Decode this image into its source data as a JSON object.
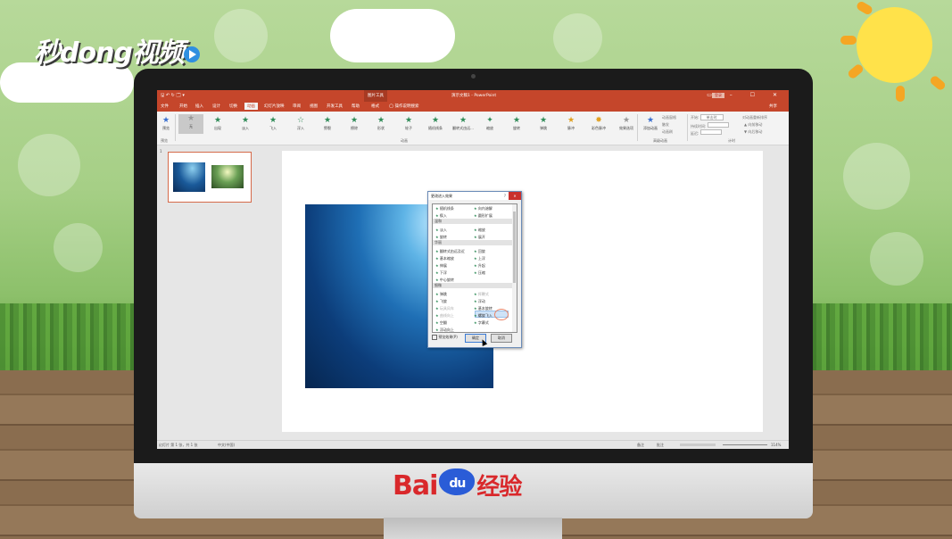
{
  "watermark": {
    "brand": "秒dong视频"
  },
  "baidu": {
    "bai": "Bai",
    "du": "du",
    "jingyan": "经验"
  },
  "window": {
    "quick_access": "🖫 ↶ ↻ 🗔 ▾",
    "context_tab": "图片工具",
    "doc_title": "演示文稿1 - PowerPoint",
    "login": "登录",
    "controls": "▭ – ☐ ✕"
  },
  "tabs": [
    "文件",
    "开始",
    "插入",
    "设计",
    "切换",
    "动画",
    "幻灯片放映",
    "审阅",
    "视图",
    "开发工具",
    "帮助",
    "格式"
  ],
  "tell_me": "操作说明搜索",
  "share": "共享",
  "ribbon": {
    "preview": "预览",
    "effects": [
      "无",
      "出现",
      "淡入",
      "飞入",
      "浮入",
      "劈裂",
      "擦除",
      "形状",
      "轮子",
      "随机线条",
      "翻转式由远...",
      "缩放",
      "旋转",
      "弹跳",
      "脉冲",
      "彩色脉冲"
    ],
    "effect_options": "效果选项",
    "add_animation": "添加动画",
    "animation_pane": "动画窗格",
    "trigger": "触发",
    "painter": "动画刷",
    "start_label": "开始:",
    "start_value": "单击时",
    "duration_label": "持续时间:",
    "delay_label": "延迟:",
    "reorder": "对动画重新排序",
    "move_earlier": "▲ 向前移动",
    "move_later": "▼ 向后移动",
    "groups": {
      "preview": "预览",
      "animation": "动画",
      "advanced": "高级动画",
      "timing": "计时"
    }
  },
  "slides_panel": {
    "number": "1"
  },
  "status": {
    "slide": "幻灯片 第 1 张，共 1 张",
    "lang": "中文(中国)",
    "notes": "备注",
    "comments": "批注",
    "zoom": "114%"
  },
  "dialog": {
    "title": "更改进入效果",
    "help": "?",
    "close": "✕",
    "groups": [
      "温和",
      "华丽",
      "细微"
    ],
    "items": [
      {
        "label": "随机线条",
        "col": 0,
        "row": 0
      },
      {
        "label": "向内溶解",
        "col": 1,
        "row": 0
      },
      {
        "label": "楔入",
        "col": 0,
        "row": 1
      },
      {
        "label": "圆形扩展",
        "col": 1,
        "row": 1
      },
      {
        "label": "淡入",
        "col": 0,
        "row": 3
      },
      {
        "label": "缩放",
        "col": 1,
        "row": 3
      },
      {
        "label": "旋转",
        "col": 0,
        "row": 4
      },
      {
        "label": "展开",
        "col": 1,
        "row": 4
      },
      {
        "label": "翻转式由远及近",
        "col": 0,
        "row": 6
      },
      {
        "label": "回旋",
        "col": 1,
        "row": 6
      },
      {
        "label": "基本缩放",
        "col": 0,
        "row": 7
      },
      {
        "label": "上浮",
        "col": 1,
        "row": 7
      },
      {
        "label": "伸展",
        "col": 0,
        "row": 8
      },
      {
        "label": "升起",
        "col": 1,
        "row": 8
      },
      {
        "label": "下浮",
        "col": 0,
        "row": 9
      },
      {
        "label": "压缩",
        "col": 1,
        "row": 9
      },
      {
        "label": "中心旋转",
        "col": 0,
        "row": 10
      },
      {
        "label": "弹跳",
        "col": 0,
        "row": 12
      },
      {
        "label": "挥鞭式",
        "col": 1,
        "row": 12,
        "dim": true
      },
      {
        "label": "飞旋",
        "col": 0,
        "row": 13
      },
      {
        "label": "浮动",
        "col": 1,
        "row": 13
      },
      {
        "label": "玩具风车",
        "col": 0,
        "row": 14,
        "dim": true
      },
      {
        "label": "基本旋转",
        "col": 1,
        "row": 14
      },
      {
        "label": "曲线向上",
        "col": 0,
        "row": 15,
        "dim": true
      },
      {
        "label": "螺旋飞入",
        "col": 1,
        "row": 15,
        "selected": true
      },
      {
        "label": "空翻",
        "col": 0,
        "row": 16
      },
      {
        "label": "字幕式",
        "col": 1,
        "row": 16
      },
      {
        "label": "浮动向上",
        "col": 0,
        "row": 17
      }
    ],
    "preview_label": "预览效果(P)",
    "ok": "确定",
    "cancel": "取消"
  }
}
